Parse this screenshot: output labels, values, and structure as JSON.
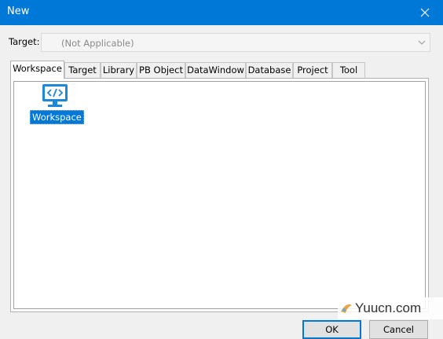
{
  "window": {
    "title": "New"
  },
  "target": {
    "label": "Target:",
    "value": "(Not Applicable)"
  },
  "tabs": [
    {
      "label": "Workspace",
      "active": true
    },
    {
      "label": "Target"
    },
    {
      "label": "Library"
    },
    {
      "label": "PB Object"
    },
    {
      "label": "DataWindow"
    },
    {
      "label": "Database"
    },
    {
      "label": "Project"
    },
    {
      "label": "Tool"
    }
  ],
  "panel": {
    "items": [
      {
        "label": "Workspace",
        "icon": "workspace-icon",
        "selected": true
      }
    ]
  },
  "buttons": {
    "ok": "OK",
    "cancel": "Cancel"
  },
  "watermark": {
    "text": "Yuucn.com"
  },
  "colors": {
    "titlebar": "#0078d7",
    "selection": "#0078d7",
    "icon": "#1e88d8"
  }
}
